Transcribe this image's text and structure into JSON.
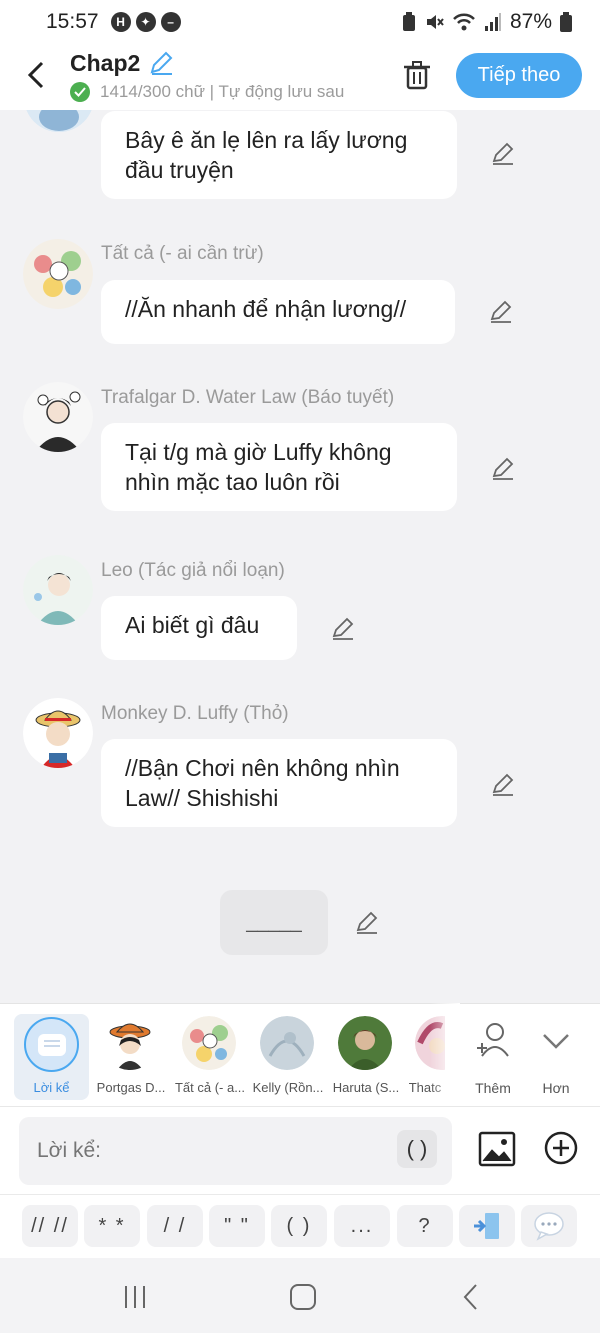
{
  "status_bar": {
    "time": "15:57",
    "battery": "87%"
  },
  "header": {
    "title": "Chap2",
    "saved_status": "1414/300 chữ | Tự động lưu sau",
    "next_label": "Tiếp theo"
  },
  "messages": [
    {
      "name": "",
      "text": "Bây ê ăn lẹ lên ra lấy lương đầu truyện"
    },
    {
      "name": "Tất cả (- ai cần trừ)",
      "text": "//Ăn nhanh để nhận lương//"
    },
    {
      "name": "Trafalgar D. Water Law (Báo tuyết)",
      "text": "Tại t/g mà giờ Luffy không nhìn mặc tao luôn rồi"
    },
    {
      "name": "Leo (Tác giả nổi loạn)",
      "text": "Ai biết gì đâu"
    },
    {
      "name": "Monkey D. Luffy (Thỏ)",
      "text": "//Bận Chơi nên không nhìn Law// Shishishi"
    }
  ],
  "blank_bubble": "_____",
  "characters": [
    {
      "label": "Lời kể"
    },
    {
      "label": "Portgas D..."
    },
    {
      "label": "Tất cả (- a..."
    },
    {
      "label": "Kelly (Rồn..."
    },
    {
      "label": "Haruta (S..."
    },
    {
      "label": "Thatc"
    }
  ],
  "tools": {
    "add_label": "Thêm",
    "more_label": "Hơn"
  },
  "input": {
    "placeholder": "Lời kể:",
    "paren": "( )"
  },
  "format_buttons": [
    "// //",
    "* *",
    "/ /",
    "\" \"",
    "( )",
    "...",
    "?"
  ],
  "colors": {
    "accent": "#4aa8f0",
    "background": "#f2f2f4",
    "check": "#4caf50"
  }
}
